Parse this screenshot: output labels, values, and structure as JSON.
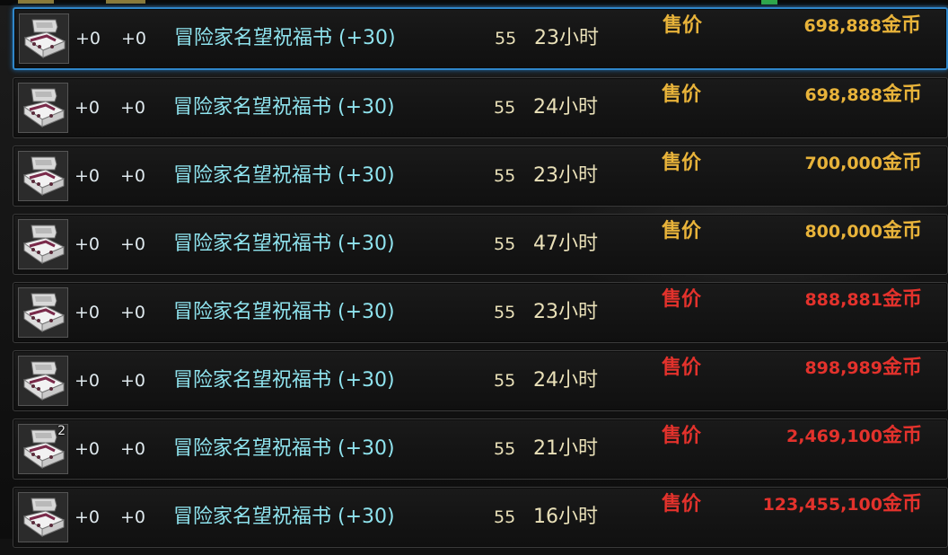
{
  "listing": {
    "rows": [
      {
        "attr1": "+0",
        "attr2": "+0",
        "name": "冒险家名望祝福书 (+30)",
        "level": "55",
        "time": "23小时",
        "price_label": "售价",
        "price": "698,888",
        "unit": "金币",
        "color": "#e8b33a",
        "count": "",
        "selected": true
      },
      {
        "attr1": "+0",
        "attr2": "+0",
        "name": "冒险家名望祝福书 (+30)",
        "level": "55",
        "time": "24小时",
        "price_label": "售价",
        "price": "698,888",
        "unit": "金币",
        "color": "#e8b33a",
        "count": "",
        "selected": false
      },
      {
        "attr1": "+0",
        "attr2": "+0",
        "name": "冒险家名望祝福书 (+30)",
        "level": "55",
        "time": "23小时",
        "price_label": "售价",
        "price": "700,000",
        "unit": "金币",
        "color": "#e8b33a",
        "count": "",
        "selected": false
      },
      {
        "attr1": "+0",
        "attr2": "+0",
        "name": "冒险家名望祝福书 (+30)",
        "level": "55",
        "time": "47小时",
        "price_label": "售价",
        "price": "800,000",
        "unit": "金币",
        "color": "#e8b33a",
        "count": "",
        "selected": false
      },
      {
        "attr1": "+0",
        "attr2": "+0",
        "name": "冒险家名望祝福书 (+30)",
        "level": "55",
        "time": "23小时",
        "price_label": "售价",
        "price": "888,881",
        "unit": "金币",
        "color": "#e3322c",
        "count": "",
        "selected": false
      },
      {
        "attr1": "+0",
        "attr2": "+0",
        "name": "冒险家名望祝福书 (+30)",
        "level": "55",
        "time": "24小时",
        "price_label": "售价",
        "price": "898,989",
        "unit": "金币",
        "color": "#e3322c",
        "count": "",
        "selected": false
      },
      {
        "attr1": "+0",
        "attr2": "+0",
        "name": "冒险家名望祝福书 (+30)",
        "level": "55",
        "time": "21小时",
        "price_label": "售价",
        "price": "2,469,100",
        "unit": "金币",
        "color": "#e3322c",
        "count": "2",
        "selected": false
      },
      {
        "attr1": "+0",
        "attr2": "+0",
        "name": "冒险家名望祝福书 (+30)",
        "level": "55",
        "time": "16小时",
        "price_label": "售价",
        "price": "123,455,100",
        "unit": "金币",
        "color": "#e3322c",
        "count": "",
        "selected": false
      }
    ]
  },
  "icons": {
    "item": "scroll-book-icon"
  },
  "colors": {
    "selected_border": "#2f86c9",
    "name": "#8fe3ee",
    "price_gold": "#e8b33a",
    "price_red": "#e3322c"
  }
}
